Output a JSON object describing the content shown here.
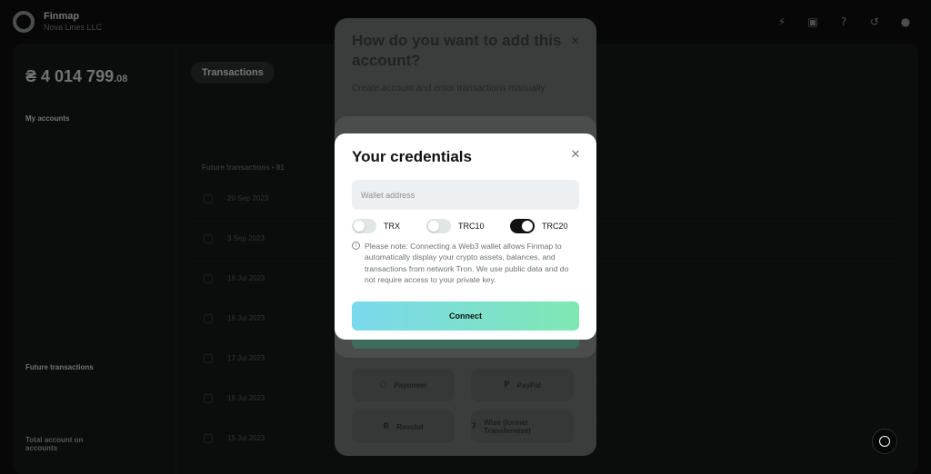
{
  "app": {
    "brand": "Finmap",
    "workspace": "Nova Lines LLC",
    "balance_main": "₴ 4 014 799",
    "balance_cents": ".08",
    "my_accounts_label": "My accounts",
    "future_transactions_label": "Future transactions",
    "total_label": "Total account on accounts",
    "tab_transactions": "Transactions",
    "future_group_label": "Future transactions • 81",
    "row_dates": [
      "20 Sep 2023",
      "3 Sep 2023",
      "16 Jul 2023",
      "16 Jul 2023",
      "17 Jul 2023",
      "16 Jul 2023",
      "15 Jul 2023"
    ]
  },
  "background_modal": {
    "title": "How do you want to add this account?",
    "subtitle": "Create account and enter transactions manually",
    "providers": [
      {
        "icon": "payoneer-icon",
        "label": "Payoneer"
      },
      {
        "icon": "paypal-icon",
        "label": "PayPal"
      },
      {
        "icon": "revolut-icon",
        "label": "Revolut"
      },
      {
        "icon": "wise-icon",
        "label": "Wise (former Transferwise)"
      }
    ]
  },
  "credentials_modal": {
    "title": "Your credentials",
    "wallet_placeholder": "Wallet address",
    "wallet_value": "",
    "toggles": [
      {
        "label": "TRX",
        "on": false
      },
      {
        "label": "TRC10",
        "on": false
      },
      {
        "label": "TRC20",
        "on": true
      }
    ],
    "note": "Please note: Connecting a Web3 wallet allows Finmap to automatically display your crypto assets, balances, and transactions from network Tron. We use public data and do not require access to your private key.",
    "connect_label": "Connect"
  },
  "colors": {
    "connect_gradient_start": "#7ad9ee",
    "connect_gradient_end": "#7fe7b2",
    "toggle_on": "#111111",
    "toggle_off": "#e2e5e6"
  }
}
